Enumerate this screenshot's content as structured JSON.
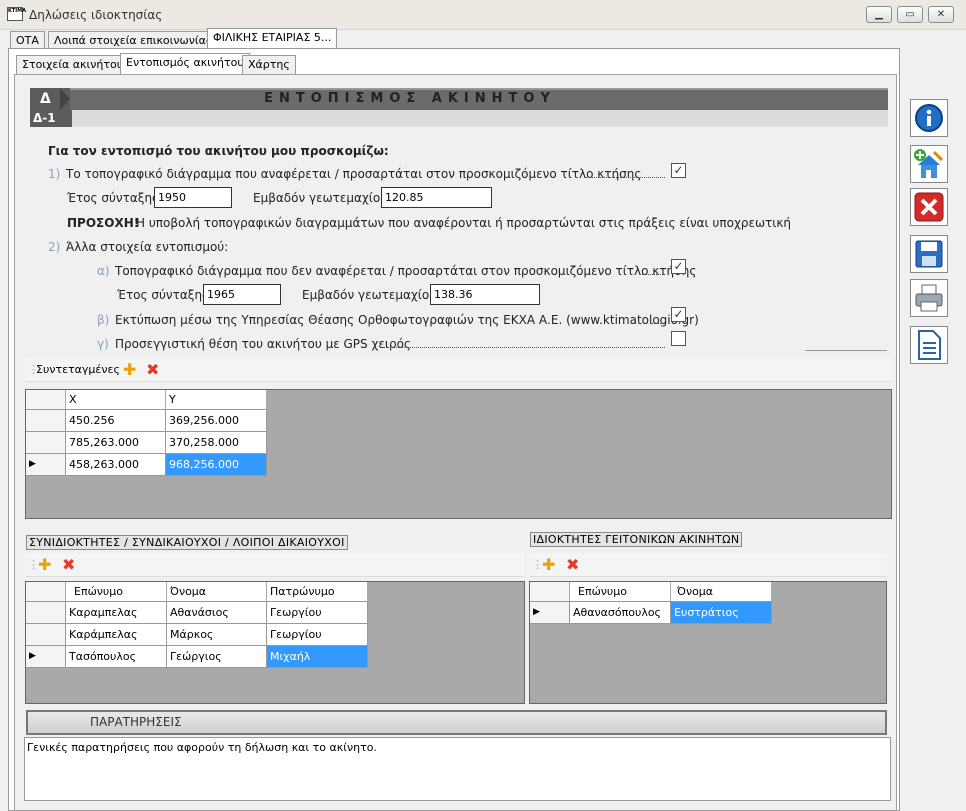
{
  "window": {
    "title": "Δηλώσεις ιδιοκτησίας",
    "app_icon_text": "KTIMA"
  },
  "main_tabs": [
    "ΟΤΑ",
    "Λοιπά στοιχεία επικοινωνίας",
    "ΦΙΛΙΚΗΣ ΕΤΑΙΡΙΑΣ 5..."
  ],
  "sub_tabs": [
    "Στοιχεία ακινήτου",
    "Εντοπισμός ακινήτου",
    "Χάρτης"
  ],
  "section": {
    "letter": "Δ",
    "title": "ΕΝΤΟΠΙΣΜΟΣ ΑΚΙΝΗΤΟΥ",
    "sub": "Δ-1"
  },
  "form": {
    "heading": "Για τον εντοπισμό του ακινήτου μου προσκομίζω:",
    "item1_num": "1)",
    "item1": "Το τοπογραφικό διάγραμμα που αναφέρεται / προσαρτάται στον προσκομιζόμενο τίτλο κτήσης",
    "year_label": "Έτος σύνταξης",
    "year1": "1950",
    "area_label": "Εμβαδόν γεωτεμαχίου",
    "area1": "120.85",
    "warning_bold": "ΠΡΟΣΟΧΗ!",
    "warning": "Η υποβολή τοπογραφικών διαγραμμάτων που αναφέρονται ή προσαρτώνται στις πράξεις είναι υποχρεωτική",
    "item2_num": "2)",
    "item2": "Άλλα στοιχεία εντοπισμού:",
    "a_num": "α)",
    "a": "Τοπογραφικό διάγραμμα που δεν αναφέρεται / προσαρτάται στον προσκομιζόμενο τίτλο κτήσης",
    "year2": "1965",
    "area2": "138.36",
    "b_num": "β)",
    "b": "Εκτύπωση μέσω της Υπηρεσίας Θέασης Ορθοφωτογραφιών της ΕΚΧΑ Α.Ε. (www.ktimatologio.gr)",
    "c_num": "γ)",
    "c": "Προσεγγιστική θέση του ακινήτου με GPS χειρός"
  },
  "coords": {
    "label": "Συντεταγμένες",
    "headers": [
      "X",
      "Y"
    ],
    "rows": [
      [
        "450.256",
        "369,256.000"
      ],
      [
        "785,263.000",
        "370,258.000"
      ],
      [
        "458,263.000",
        "968,256.000"
      ]
    ]
  },
  "owners": {
    "title": "ΣΥΝΙΔΙΟΚΤΗΤΕΣ  /  ΣΥΝΔΙΚΑΙΟΥΧΟΙ  /  ΛΟΙΠΟΙ ΔΙΚΑΙΟΥΧΟΙ",
    "headers": [
      "Επώνυμο",
      "Όνομα",
      "Πατρώνυμο"
    ],
    "rows": [
      [
        "Καραμπελας",
        "Αθανάσιος",
        "Γεωργίου"
      ],
      [
        "Καράμπελας",
        "Μάρκος",
        "Γεωργίου"
      ],
      [
        "Τασόπουλος",
        "Γεώργιος",
        "Μιχαήλ"
      ]
    ]
  },
  "neighbors": {
    "title": "ΙΔΙΟΚΤΗΤΕΣ ΓΕΙΤΟΝΙΚΩΝ ΑΚΙΝΗΤΩΝ",
    "headers": [
      "Επώνυμο",
      "Όνομα"
    ],
    "rows": [
      [
        "Αθανασόπουλος",
        "Ευστράτιος"
      ]
    ]
  },
  "remarks": {
    "title": "ΠΑΡΑΤΗΡΗΣΕΙΣ",
    "text": "Γενικές παρατηρήσεις που αφορούν τη δήλωση και το ακίνητο."
  },
  "icons": [
    "info-icon",
    "add-property-icon",
    "delete-icon",
    "save-icon",
    "print-icon",
    "document-icon"
  ]
}
